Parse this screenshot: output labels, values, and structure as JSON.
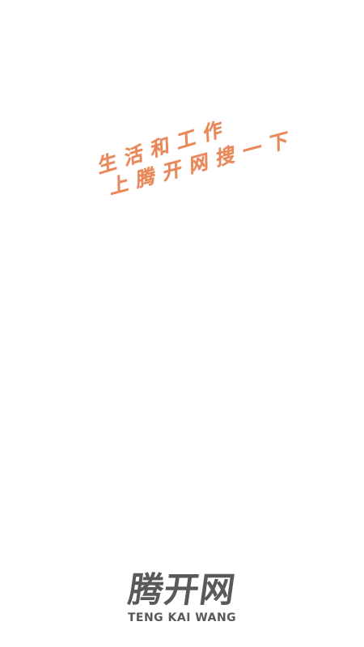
{
  "splash": {
    "slogan_line_1": "生活和工作",
    "slogan_line_2": "上腾开网搜一下",
    "brand_name_cn": "腾开网",
    "brand_name_en": "TENG KAI WANG"
  },
  "colors": {
    "background": "#ffffff",
    "slogan": "#e9895b",
    "logo": "#595959"
  }
}
